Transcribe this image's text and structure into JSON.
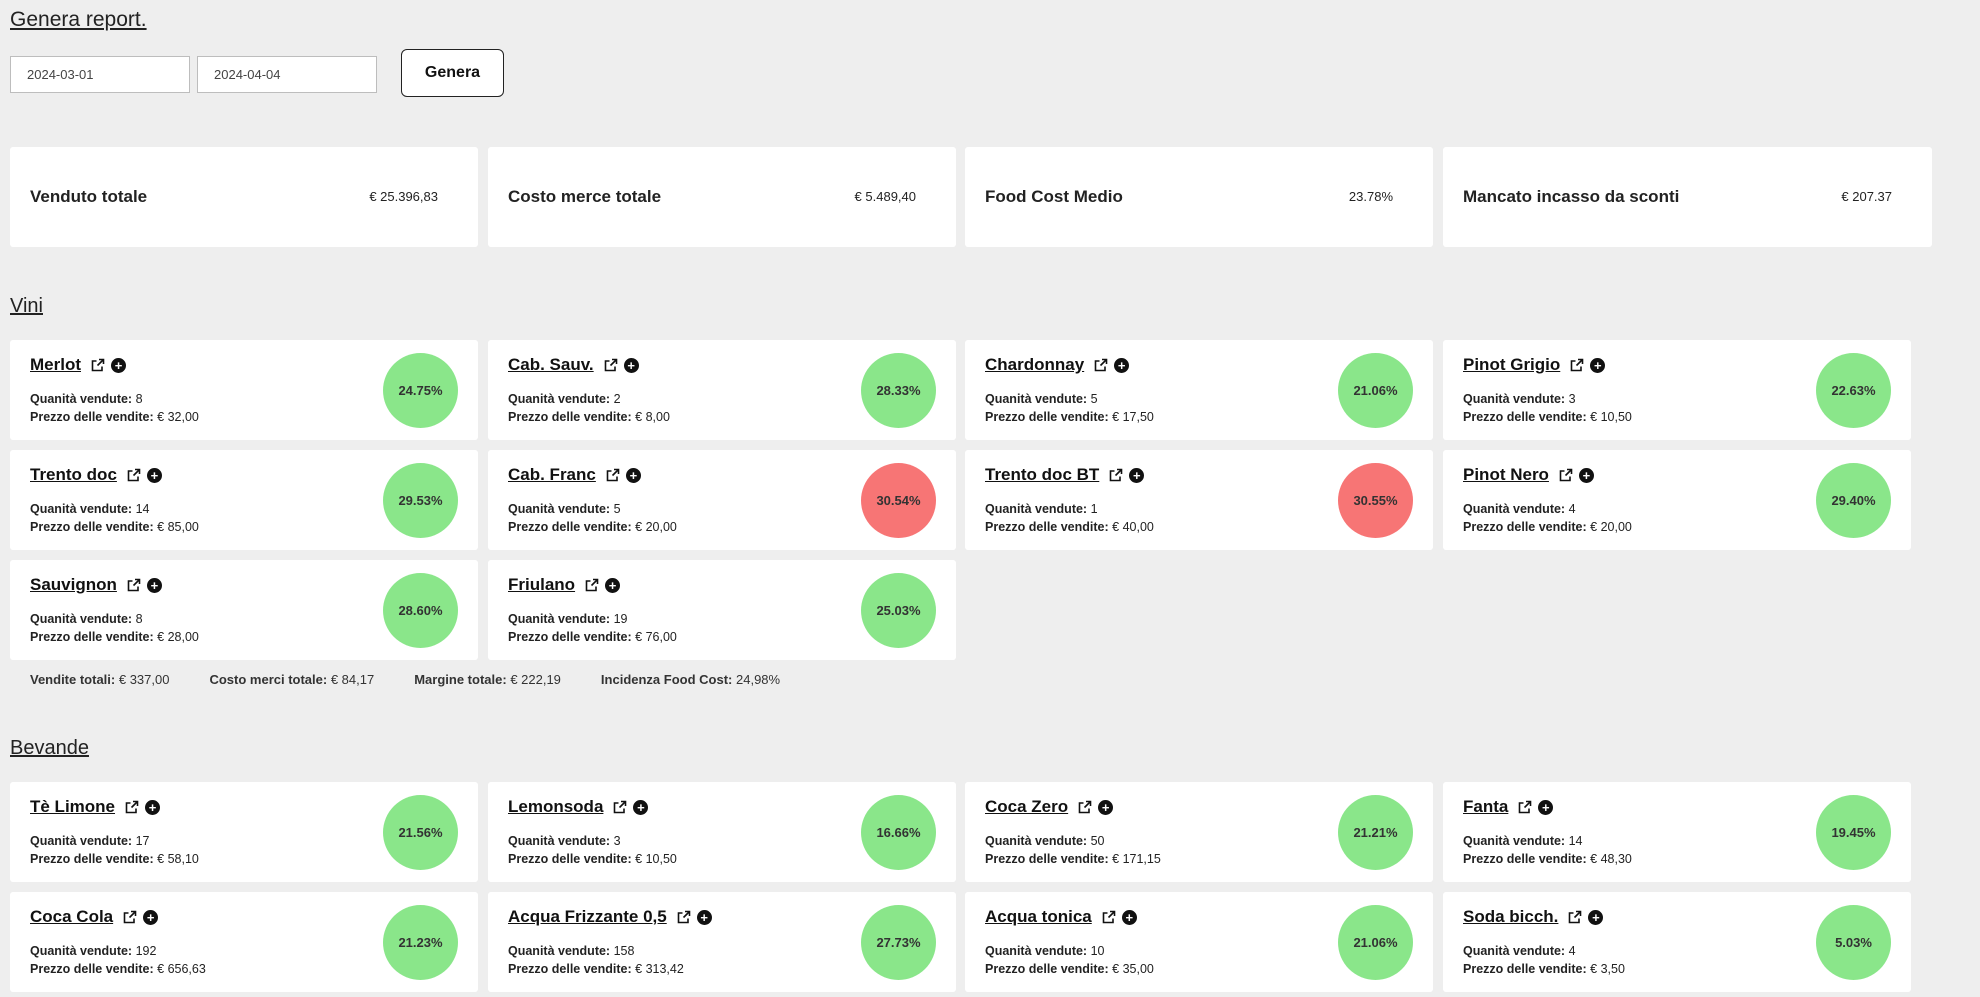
{
  "page": {
    "title": "Genera report."
  },
  "form": {
    "date_from": "2024-03-01",
    "date_to": "2024-04-04",
    "generate_label": "Genera"
  },
  "summary": [
    {
      "label": "Venduto totale",
      "value": "€ 25.396,83"
    },
    {
      "label": "Costo merce totale",
      "value": "€ 5.489,40"
    },
    {
      "label": "Food Cost Medio",
      "value": "23.78%"
    },
    {
      "label": "Mancato incasso da sconti",
      "value": "€ 207.37"
    }
  ],
  "labels": {
    "qty": "Quanità vendute:",
    "price": "Prezzo delle vendite:"
  },
  "sections": {
    "vini": {
      "title": "Vini",
      "items": [
        {
          "name": "Merlot",
          "qty": "8",
          "price": "€ 32,00",
          "food_cost": "24.75%",
          "status": "green"
        },
        {
          "name": "Cab. Sauv.",
          "qty": "2",
          "price": "€ 8,00",
          "food_cost": "28.33%",
          "status": "green"
        },
        {
          "name": "Chardonnay",
          "qty": "5",
          "price": "€ 17,50",
          "food_cost": "21.06%",
          "status": "green"
        },
        {
          "name": "Pinot Grigio",
          "qty": "3",
          "price": "€ 10,50",
          "food_cost": "22.63%",
          "status": "green"
        },
        {
          "name": "Trento doc",
          "qty": "14",
          "price": "€ 85,00",
          "food_cost": "29.53%",
          "status": "green"
        },
        {
          "name": "Cab. Franc",
          "qty": "5",
          "price": "€ 20,00",
          "food_cost": "30.54%",
          "status": "red"
        },
        {
          "name": "Trento doc BT",
          "qty": "1",
          "price": "€ 40,00",
          "food_cost": "30.55%",
          "status": "red"
        },
        {
          "name": "Pinot Nero",
          "qty": "4",
          "price": "€ 20,00",
          "food_cost": "29.40%",
          "status": "green"
        },
        {
          "name": "Sauvignon",
          "qty": "8",
          "price": "€ 28,00",
          "food_cost": "28.60%",
          "status": "green"
        },
        {
          "name": "Friulano",
          "qty": "19",
          "price": "€ 76,00",
          "food_cost": "25.03%",
          "status": "green"
        }
      ],
      "totals": {
        "sales_label": "Vendite totali:",
        "sales": "€ 337,00",
        "cost_label": "Costo merci totale:",
        "cost": "€ 84,17",
        "margin_label": "Margine totale:",
        "margin": "€ 222,19",
        "incidence_label": "Incidenza Food Cost:",
        "incidence": "24,98%"
      }
    },
    "bevande": {
      "title": "Bevande",
      "items": [
        {
          "name": "Tè Limone",
          "qty": "17",
          "price": "€ 58,10",
          "food_cost": "21.56%",
          "status": "green"
        },
        {
          "name": "Lemonsoda",
          "qty": "3",
          "price": "€ 10,50",
          "food_cost": "16.66%",
          "status": "green"
        },
        {
          "name": "Coca Zero",
          "qty": "50",
          "price": "€ 171,15",
          "food_cost": "21.21%",
          "status": "green"
        },
        {
          "name": "Fanta",
          "qty": "14",
          "price": "€ 48,30",
          "food_cost": "19.45%",
          "status": "green"
        },
        {
          "name": "Coca Cola",
          "qty": "192",
          "price": "€ 656,63",
          "food_cost": "21.23%",
          "status": "green"
        },
        {
          "name": "Acqua Frizzante 0,5",
          "qty": "158",
          "price": "€ 313,42",
          "food_cost": "27.73%",
          "status": "green"
        },
        {
          "name": "Acqua tonica",
          "qty": "10",
          "price": "€ 35,00",
          "food_cost": "21.06%",
          "status": "green"
        },
        {
          "name": "Soda bicch.",
          "qty": "4",
          "price": "€ 3,50",
          "food_cost": "5.03%",
          "status": "green"
        }
      ]
    }
  },
  "colors": {
    "good": "#8ae68a",
    "bad": "#f77575",
    "background": "#eeeeee"
  },
  "icons": {
    "open": "external-link-icon",
    "add": "plus-circle-icon"
  }
}
